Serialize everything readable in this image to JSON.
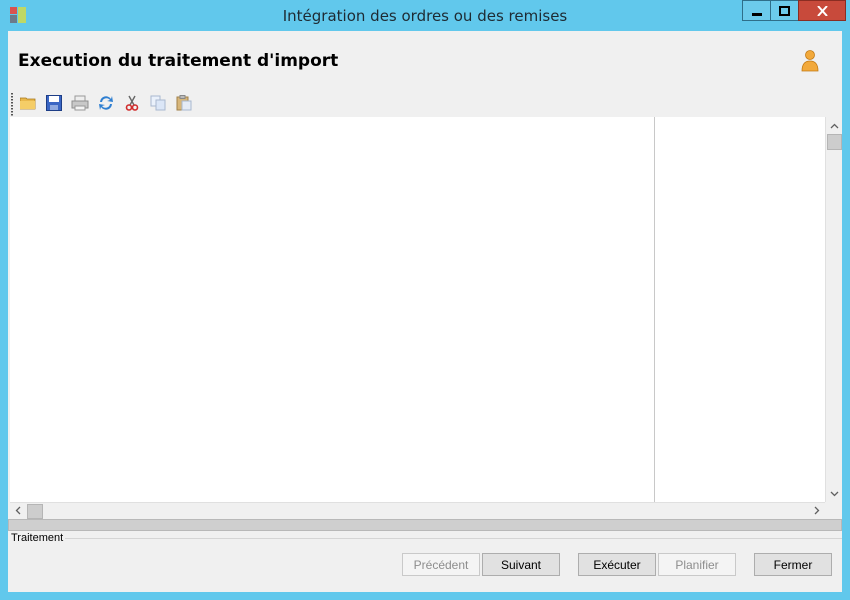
{
  "window": {
    "title": "Intégration des ordres ou des remises",
    "icon": "app-icon",
    "controls": {
      "minimize_icon": "minimize-icon",
      "maximize_icon": "maximize-icon",
      "close_icon": "close-icon"
    }
  },
  "header": {
    "title": "Execution du traitement d'import",
    "user_icon": "user-icon"
  },
  "toolbar": {
    "items": [
      {
        "icon": "open-folder-icon",
        "enabled": true
      },
      {
        "icon": "save-icon",
        "enabled": true
      },
      {
        "icon": "print-icon",
        "enabled": false
      },
      {
        "icon": "refresh-icon",
        "enabled": true
      },
      {
        "icon": "cut-icon",
        "enabled": true
      },
      {
        "icon": "copy-icon",
        "enabled": false
      },
      {
        "icon": "paste-icon",
        "enabled": false
      }
    ]
  },
  "progress": {
    "value": 0
  },
  "group": {
    "label": "Traitement"
  },
  "buttons": {
    "previous": "Précédent",
    "next": "Suivant",
    "execute": "Exécuter",
    "schedule": "Planifier",
    "close": "Fermer"
  },
  "colors": {
    "title_bar": "#61c8ec",
    "close_button": "#c84a3b",
    "client_background": "#f0f0f0"
  }
}
